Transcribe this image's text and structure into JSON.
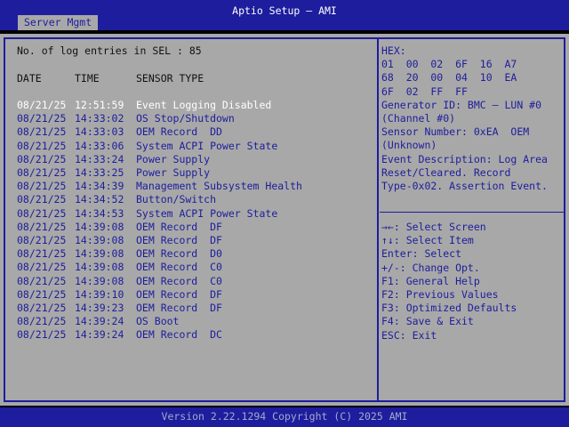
{
  "header": {
    "title": "Aptio Setup – AMI",
    "tab": "Server Mgmt"
  },
  "sel": {
    "count_label": "No. of log entries in SEL : 85",
    "columns": [
      "DATE",
      "TIME",
      "SENSOR TYPE"
    ],
    "entries": [
      {
        "date": "08/21/25",
        "time": "12:51:59",
        "type": "Event Logging Disabled"
      },
      {
        "date": "08/21/25",
        "time": "14:33:02",
        "type": "OS Stop/Shutdown"
      },
      {
        "date": "08/21/25",
        "time": "14:33:03",
        "type": "OEM Record  DD"
      },
      {
        "date": "08/21/25",
        "time": "14:33:06",
        "type": "System ACPI Power State"
      },
      {
        "date": "08/21/25",
        "time": "14:33:24",
        "type": "Power Supply"
      },
      {
        "date": "08/21/25",
        "time": "14:33:25",
        "type": "Power Supply"
      },
      {
        "date": "08/21/25",
        "time": "14:34:39",
        "type": "Management Subsystem Health"
      },
      {
        "date": "08/21/25",
        "time": "14:34:52",
        "type": "Button/Switch"
      },
      {
        "date": "08/21/25",
        "time": "14:34:53",
        "type": "System ACPI Power State"
      },
      {
        "date": "08/21/25",
        "time": "14:39:08",
        "type": "OEM Record  DF"
      },
      {
        "date": "08/21/25",
        "time": "14:39:08",
        "type": "OEM Record  DF"
      },
      {
        "date": "08/21/25",
        "time": "14:39:08",
        "type": "OEM Record  D0"
      },
      {
        "date": "08/21/25",
        "time": "14:39:08",
        "type": "OEM Record  C0"
      },
      {
        "date": "08/21/25",
        "time": "14:39:08",
        "type": "OEM Record  C0"
      },
      {
        "date": "08/21/25",
        "time": "14:39:10",
        "type": "OEM Record  DF"
      },
      {
        "date": "08/21/25",
        "time": "14:39:23",
        "type": "OEM Record  DF"
      },
      {
        "date": "08/21/25",
        "time": "14:39:24",
        "type": "OS Boot"
      },
      {
        "date": "08/21/25",
        "time": "14:39:24",
        "type": "OEM Record  DC"
      }
    ]
  },
  "details": [
    "HEX:",
    "01  00  02  6F  16  A7",
    "68  20  00  04  10  EA",
    "6F  02  FF  FF",
    "Generator ID: BMC – LUN #0",
    "(Channel #0)",
    "Sensor Number: 0xEA  OEM",
    "(Unknown)",
    "Event Description: Log Area",
    "Reset/Cleared. Record",
    "Type-0x02. Assertion Event."
  ],
  "help": [
    "→←: Select Screen",
    "↑↓: Select Item",
    "Enter: Select",
    "+/-: Change Opt.",
    "F1: General Help",
    "F2: Previous Values",
    "F3: Optimized Defaults",
    "F4: Save & Exit",
    "ESC: Exit"
  ],
  "footer": "Version 2.22.1294 Copyright (C) 2025 AMI"
}
